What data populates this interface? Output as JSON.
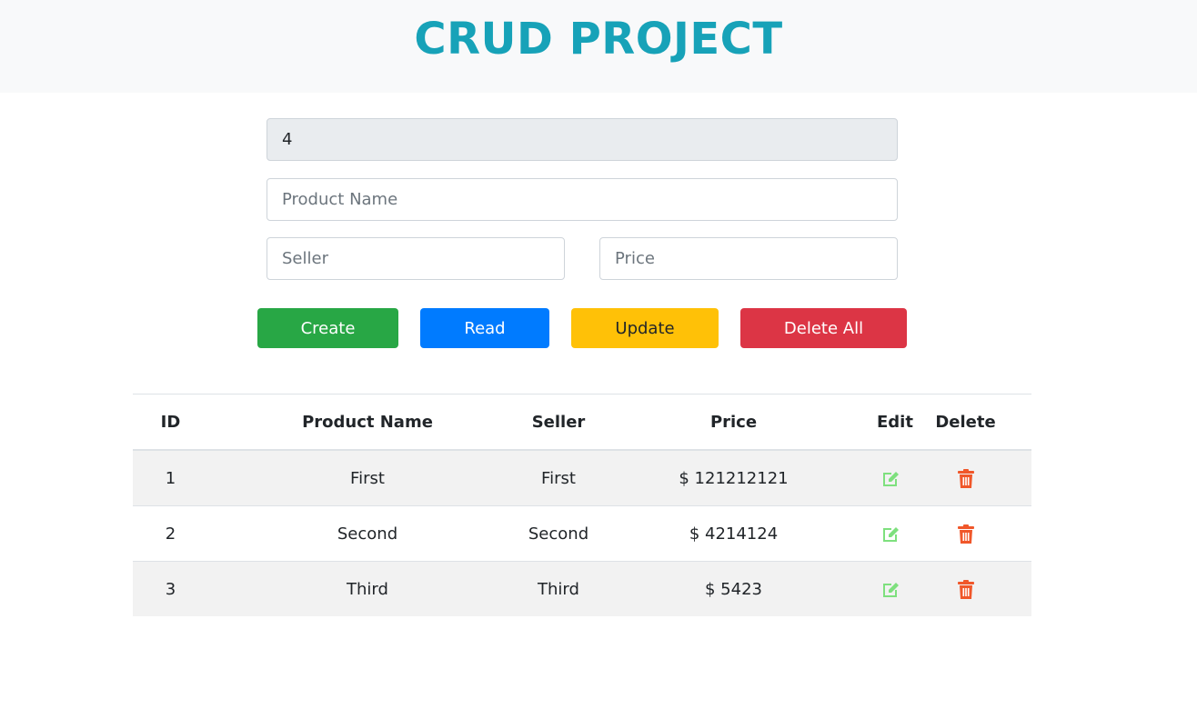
{
  "header": {
    "title": "CRUD PROJECT"
  },
  "form": {
    "id_value": "4",
    "product_name_placeholder": "Product Name",
    "seller_placeholder": "Seller",
    "price_placeholder": "Price"
  },
  "buttons": {
    "create": "Create",
    "read": "Read",
    "update": "Update",
    "delete_all": "Delete All"
  },
  "table": {
    "headers": [
      "ID",
      "Product Name",
      "Seller",
      "Price",
      "Edit",
      "Delete"
    ],
    "rows": [
      {
        "id": "1",
        "name": "First",
        "seller": "First",
        "price": "$ 121212121"
      },
      {
        "id": "2",
        "name": "Second",
        "seller": "Second",
        "price": "$ 4214124"
      },
      {
        "id": "3",
        "name": "Third",
        "seller": "Third",
        "price": "$ 5423"
      }
    ]
  },
  "icons": {
    "edit": "edit-icon",
    "delete": "trash-icon"
  },
  "colors": {
    "title": "#17a2b8",
    "create": "#28a745",
    "read": "#007bff",
    "update": "#ffc107",
    "delete": "#dc3545",
    "edit_icon": "#7ee07e",
    "trash_icon": "#f0572a"
  }
}
